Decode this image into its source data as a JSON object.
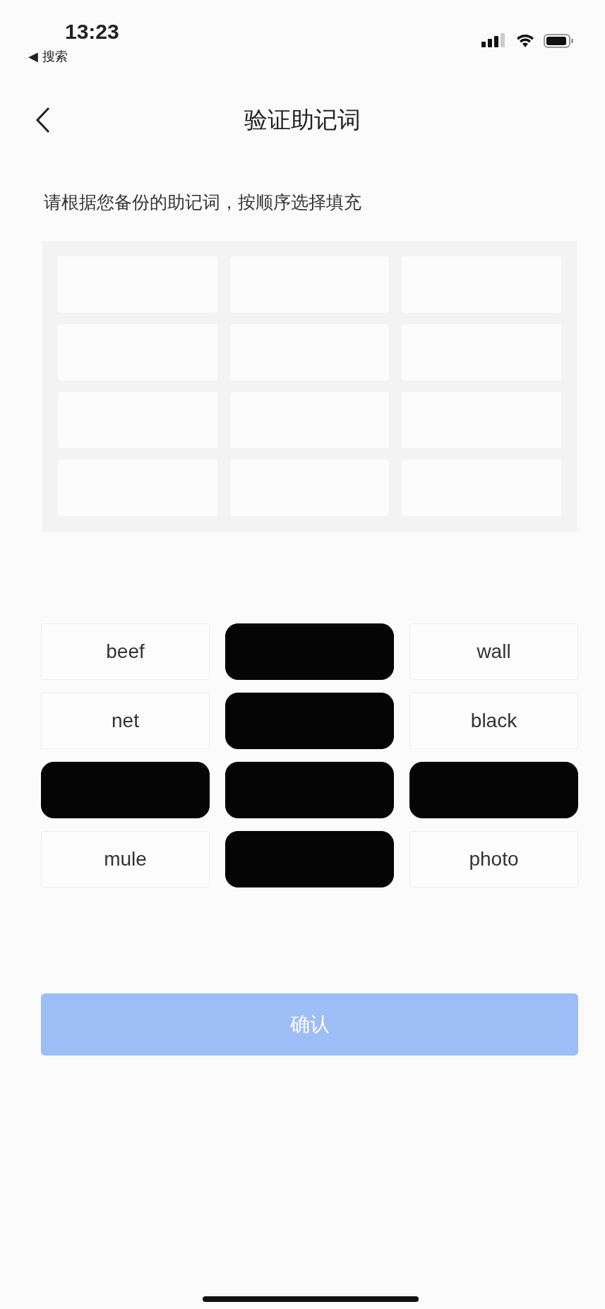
{
  "status_bar": {
    "time": "13:23",
    "back_app": "◀ 搜索"
  },
  "nav": {
    "title": "验证助记词"
  },
  "instruction": "请根据您备份的助记词，按顺序选择填充",
  "slots": [
    {
      "filled": false
    },
    {
      "filled": false
    },
    {
      "filled": false
    },
    {
      "filled": false
    },
    {
      "filled": false
    },
    {
      "filled": false
    },
    {
      "filled": false
    },
    {
      "filled": false
    },
    {
      "filled": false
    },
    {
      "filled": false
    },
    {
      "filled": false
    },
    {
      "filled": false
    }
  ],
  "words": [
    {
      "word": "beef",
      "covered": false
    },
    {
      "covered": true
    },
    {
      "word": "wall",
      "covered": false
    },
    {
      "word": "net",
      "covered": false
    },
    {
      "covered": true
    },
    {
      "word": "black",
      "covered": false
    },
    {
      "covered": true
    },
    {
      "covered": true
    },
    {
      "covered": true
    },
    {
      "word": "mule",
      "covered": false
    },
    {
      "covered": true
    },
    {
      "word": "photo",
      "covered": false
    }
  ],
  "confirm_button": {
    "label": "确认",
    "disabled": true
  }
}
